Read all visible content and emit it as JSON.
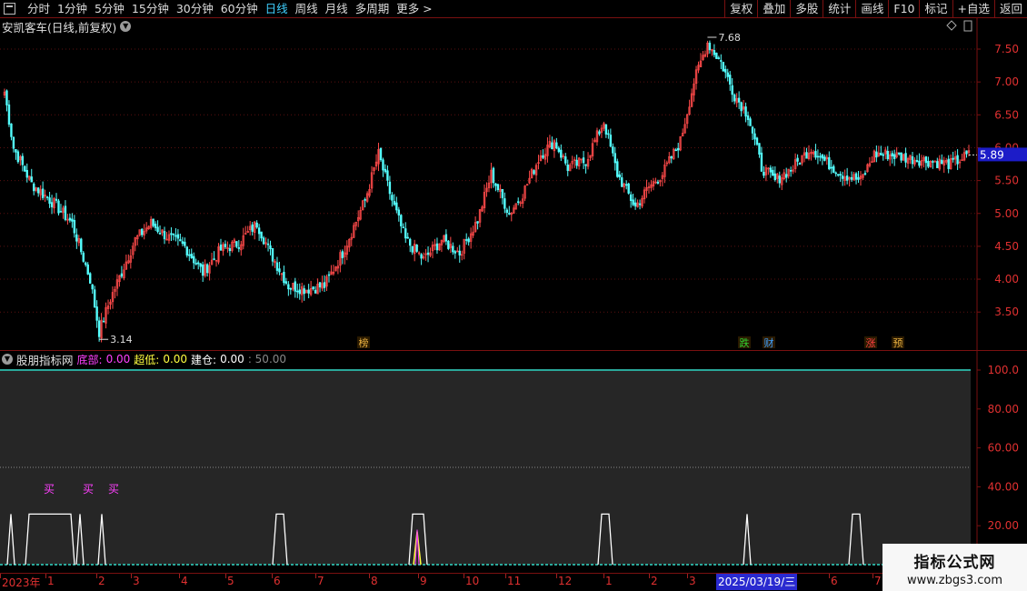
{
  "toolbar": {
    "periods": [
      "分时",
      "1分钟",
      "5分钟",
      "15分钟",
      "30分钟",
      "60分钟",
      "日线",
      "周线",
      "月线",
      "多周期",
      "更多 >"
    ],
    "active_period": "日线",
    "tools": [
      "复权",
      "叠加",
      "多股",
      "统计",
      "画线",
      "F10",
      "标记",
      "+自选",
      "返回"
    ]
  },
  "main_chart": {
    "title": "安凯客车(日线,前复权)",
    "price_axis": [
      "7.50",
      "7.00",
      "6.50",
      "6.00",
      "5.50",
      "5.00",
      "4.50",
      "4.00",
      "3.50"
    ],
    "current_price": "5.89",
    "high_label": "7.68",
    "low_label": "3.14",
    "event_markers": [
      {
        "label": "榜",
        "color": "#e8b040"
      },
      {
        "label": "跌",
        "color": "#30d030"
      },
      {
        "label": "财",
        "color": "#40a0ff"
      },
      {
        "label": "涨",
        "color": "#ff4040"
      },
      {
        "label": "预",
        "color": "#e8b040"
      }
    ]
  },
  "indicator": {
    "name": "股朋指标网",
    "fields": [
      {
        "label": "底部:",
        "value": "0.00",
        "color": "#ff40ff"
      },
      {
        "label": "超低:",
        "value": "0.00",
        "color": "#ffff40"
      },
      {
        "label": "建仓:",
        "value": "0.00",
        "color": "#ffffff"
      }
    ],
    "extra": ": 50.00",
    "axis": [
      "100.0",
      "80.00",
      "60.00",
      "40.00",
      "20.00"
    ],
    "buy_label": "买"
  },
  "date_axis": {
    "labels": [
      "2023年",
      "1",
      "2",
      "3",
      "4",
      "5",
      "6",
      "7",
      "8",
      "9",
      "10",
      "11",
      "12",
      "1",
      "2",
      "3",
      "5",
      "6",
      "7"
    ],
    "cursor_date": "2025/03/19/三"
  },
  "watermark": {
    "title": "指标公式网",
    "url": "www.zbgs3.com"
  },
  "colors": {
    "up": "#ff4a4a",
    "down": "#54ffff",
    "grid": "#7a1010",
    "accent": "#3fd0ff"
  }
}
